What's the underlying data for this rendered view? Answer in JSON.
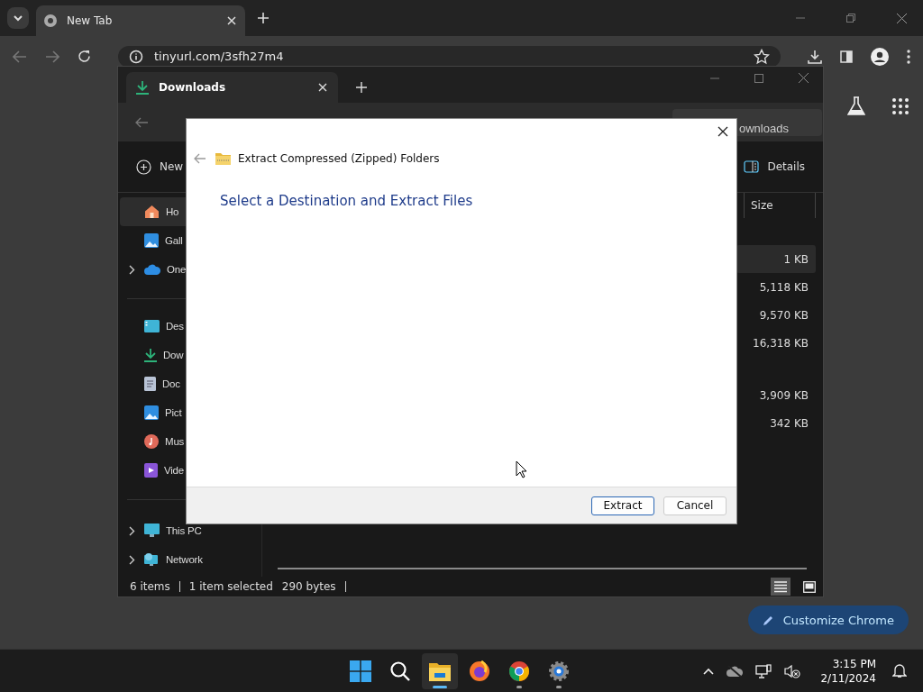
{
  "browser": {
    "tabs": [
      {
        "title": "New Tab",
        "selected": true
      }
    ],
    "url": "tinyurl.com/3sfh27m4",
    "customize_button": "Customize Chrome"
  },
  "explorer": {
    "tab_title": "Downloads",
    "search_text": "ownloads",
    "new_label": "New",
    "details_label": "Details",
    "sidebar": [
      [
        {
          "label": "Ho",
          "kind": "home",
          "expandable": false,
          "selected": true
        },
        {
          "label": "Gall",
          "kind": "gallery",
          "expandable": false,
          "selected": false
        },
        {
          "label": "One",
          "kind": "cloud",
          "expandable": true,
          "selected": false
        }
      ],
      [
        {
          "label": "Des",
          "kind": "desktop",
          "expandable": false,
          "selected": false
        },
        {
          "label": "Dow",
          "kind": "download",
          "expandable": false,
          "selected": false
        },
        {
          "label": "Doc",
          "kind": "document",
          "expandable": false,
          "selected": false
        },
        {
          "label": "Pict",
          "kind": "pictures",
          "expandable": false,
          "selected": false
        },
        {
          "label": "Mus",
          "kind": "music",
          "expandable": false,
          "selected": false
        },
        {
          "label": "Vide",
          "kind": "video",
          "expandable": false,
          "selected": false
        }
      ],
      [
        {
          "label": "This PC",
          "kind": "pc",
          "expandable": true,
          "selected": false
        },
        {
          "label": "Network",
          "kind": "network",
          "expandable": true,
          "selected": false
        }
      ]
    ],
    "size_header": "Size",
    "groups": [
      [
        {
          "size": "1 KB",
          "selected": true
        },
        {
          "size": "5,118 KB",
          "selected": false
        },
        {
          "size": "9,570 KB",
          "selected": false
        },
        {
          "size": "16,318 KB",
          "selected": false
        }
      ],
      [
        {
          "size": "3,909 KB",
          "selected": false
        },
        {
          "size": "342 KB",
          "selected": false
        }
      ]
    ],
    "status": {
      "count": "6 items",
      "selection": "1 item selected",
      "selection_size": "290 bytes"
    },
    "views": [
      {
        "kind": "details",
        "selected": true
      },
      {
        "kind": "tiles",
        "selected": false
      }
    ]
  },
  "dialog": {
    "title": "Extract Compressed (Zipped) Folders",
    "heading": "Select a Destination and Extract Files",
    "buttons": [
      {
        "label": "Extract",
        "default": true
      },
      {
        "label": "Cancel",
        "default": false
      }
    ]
  },
  "taskbar": {
    "apps": [
      {
        "kind": "start",
        "active": false,
        "running": false
      },
      {
        "kind": "search",
        "active": false,
        "running": false
      },
      {
        "kind": "explorer",
        "active": true,
        "running": true
      },
      {
        "kind": "firefox",
        "active": false,
        "running": false
      },
      {
        "kind": "chrome",
        "active": false,
        "running": true
      },
      {
        "kind": "settings",
        "active": false,
        "running": true
      }
    ],
    "time": "3:15 PM",
    "date": "2/11/2024"
  }
}
